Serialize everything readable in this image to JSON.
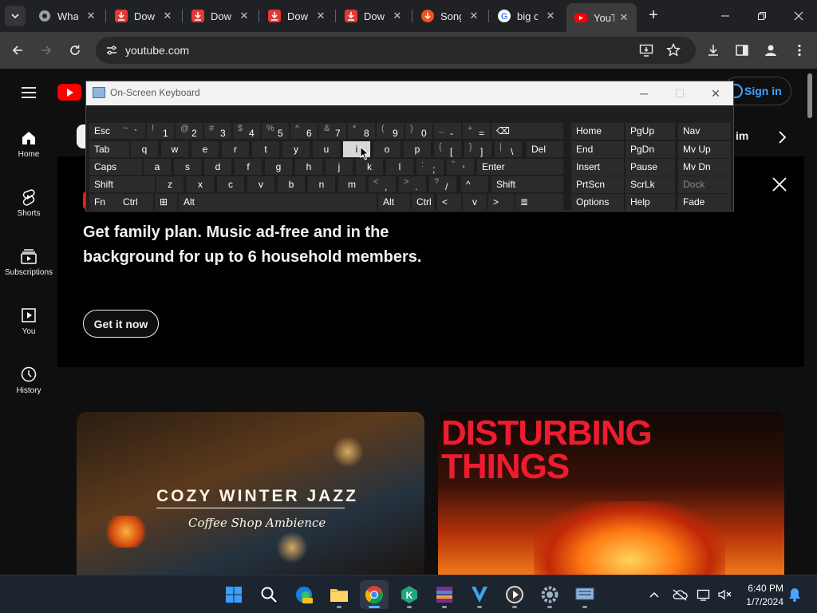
{
  "browser": {
    "tabs": [
      {
        "title": "Wha",
        "favicon": "google-chrome-icon",
        "color": "#5f6368"
      },
      {
        "title": "Dow",
        "favicon": "download-icon",
        "color": "#e53935"
      },
      {
        "title": "Dow",
        "favicon": "download-icon",
        "color": "#e53935"
      },
      {
        "title": "Dow",
        "favicon": "download-icon",
        "color": "#e53935"
      },
      {
        "title": "Dow",
        "favicon": "download-icon",
        "color": "#e53935"
      },
      {
        "title": "Song",
        "favicon": "download-orange-icon",
        "color": "#f4511e"
      },
      {
        "title": "big c",
        "favicon": "google-icon",
        "color": "#ffffff"
      },
      {
        "title": "YouT",
        "favicon": "youtube-icon",
        "color": "#ff0000",
        "active": true
      }
    ],
    "new_tab": "+",
    "url": "youtube.com"
  },
  "youtube": {
    "sign_in": "Sign in",
    "chip_fragment": "im",
    "sidebar": [
      {
        "label": "Home",
        "icon": "home-icon"
      },
      {
        "label": "Shorts",
        "icon": "shorts-icon"
      },
      {
        "label": "Subscriptions",
        "icon": "subscriptions-icon"
      },
      {
        "label": "You",
        "icon": "you-icon"
      },
      {
        "label": "History",
        "icon": "history-icon"
      }
    ],
    "promo": {
      "title": "Get family plan. Music ad-free and in the background for up to 6 household members.",
      "button": "Get it now"
    },
    "thumbnails": [
      {
        "title": "COZY WINTER JAZZ",
        "subtitle": "Coffee Shop Ambience"
      },
      {
        "title_line1": "DISTURBING",
        "title_line2": "THINGS"
      }
    ]
  },
  "osk": {
    "title": "On-Screen Keyboard",
    "rows": [
      [
        [
          "Esc",
          ""
        ],
        [
          "`",
          "~"
        ],
        [
          "1",
          "!"
        ],
        [
          "2",
          "@"
        ],
        [
          "3",
          "#"
        ],
        [
          "4",
          "$"
        ],
        [
          "5",
          "%"
        ],
        [
          "6",
          "^"
        ],
        [
          "7",
          "&"
        ],
        [
          "8",
          "*"
        ],
        [
          "9",
          "("
        ],
        [
          "0",
          ")"
        ],
        [
          "-",
          "_"
        ],
        [
          "=",
          "+"
        ],
        [
          "⌫",
          ""
        ]
      ],
      [
        [
          "Tab",
          ""
        ],
        [
          "q",
          ""
        ],
        [
          "w",
          ""
        ],
        [
          "e",
          ""
        ],
        [
          "r",
          ""
        ],
        [
          "t",
          ""
        ],
        [
          "y",
          ""
        ],
        [
          "u",
          ""
        ],
        [
          "i",
          ""
        ],
        [
          "o",
          ""
        ],
        [
          "p",
          ""
        ],
        [
          "[",
          "{"
        ],
        [
          "]",
          "}"
        ],
        [
          "\\",
          "|"
        ],
        [
          "Del",
          ""
        ]
      ],
      [
        [
          "Caps",
          ""
        ],
        [
          "a",
          ""
        ],
        [
          "s",
          ""
        ],
        [
          "d",
          ""
        ],
        [
          "f",
          ""
        ],
        [
          "g",
          ""
        ],
        [
          "h",
          ""
        ],
        [
          "j",
          ""
        ],
        [
          "k",
          ""
        ],
        [
          "l",
          ""
        ],
        [
          ";",
          ":"
        ],
        [
          "'",
          "\""
        ],
        [
          "Enter",
          ""
        ]
      ],
      [
        [
          "Shift",
          ""
        ],
        [
          "z",
          ""
        ],
        [
          "x",
          ""
        ],
        [
          "c",
          ""
        ],
        [
          "v",
          ""
        ],
        [
          "b",
          ""
        ],
        [
          "n",
          ""
        ],
        [
          "m",
          ""
        ],
        [
          ",",
          "<"
        ],
        [
          ".",
          ">"
        ],
        [
          "/",
          "?"
        ],
        [
          "^",
          ""
        ],
        [
          "Shift",
          ""
        ]
      ],
      [
        [
          "Fn",
          ""
        ],
        [
          "Ctrl",
          ""
        ],
        [
          "⊞",
          ""
        ],
        [
          "Alt",
          ""
        ],
        [
          "",
          ""
        ],
        [
          "Alt",
          ""
        ],
        [
          "Ctrl",
          ""
        ],
        [
          "<",
          ""
        ],
        [
          "v",
          ""
        ],
        [
          ">",
          ""
        ],
        [
          "≣",
          ""
        ]
      ]
    ],
    "nav": [
      [
        "Home",
        "PgUp",
        "Nav"
      ],
      [
        "End",
        "PgDn",
        "Mv Up"
      ],
      [
        "Insert",
        "Pause",
        "Mv Dn"
      ],
      [
        "PrtScn",
        "ScrLk",
        "Dock"
      ],
      [
        "Options",
        "Help",
        "Fade"
      ]
    ],
    "highlighted_key": "i"
  },
  "taskbar": {
    "apps": [
      "windows-start-icon",
      "search-icon",
      "edge-pre-icon",
      "file-explorer-icon",
      "chrome-icon",
      "kaspersky-icon",
      "winrar-icon",
      "editor-icon",
      "media-player-icon",
      "settings-icon",
      "osk-icon"
    ],
    "time": "6:40 PM",
    "date": "1/7/2024"
  }
}
